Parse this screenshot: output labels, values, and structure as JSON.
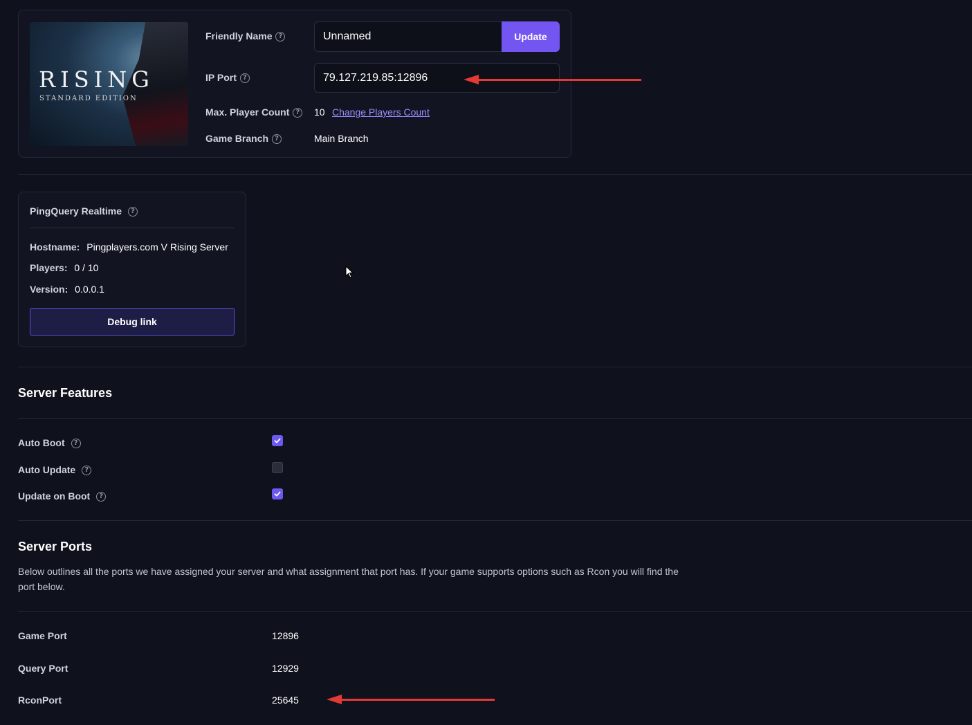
{
  "cover": {
    "title": "RISING",
    "edition": "STANDARD EDITION"
  },
  "info": {
    "friendly_name_label": "Friendly Name",
    "friendly_name_value": "Unnamed",
    "update_label": "Update",
    "ip_port_label": "IP Port",
    "ip_port_value": "79.127.219.85:12896",
    "max_players_label": "Max. Player Count",
    "max_players_value": "10",
    "change_players_link": "Change Players Count",
    "game_branch_label": "Game Branch",
    "game_branch_value": "Main Branch"
  },
  "ping": {
    "title": "PingQuery Realtime",
    "hostname_label": "Hostname:",
    "hostname_value": "Pingplayers.com V Rising Server",
    "players_label": "Players:",
    "players_value": "0 / 10",
    "version_label": "Version:",
    "version_value": "0.0.0.1",
    "debug_label": "Debug link"
  },
  "features": {
    "title": "Server Features",
    "items": [
      {
        "label": "Auto Boot",
        "checked": true
      },
      {
        "label": "Auto Update",
        "checked": false
      },
      {
        "label": "Update on Boot",
        "checked": true
      }
    ]
  },
  "ports": {
    "title": "Server Ports",
    "description": "Below outlines all the ports we have assigned your server and what assignment that port has. If your game supports options such as Rcon you will find the port below.",
    "rows": [
      {
        "label": "Game Port",
        "value": "12896"
      },
      {
        "label": "Query Port",
        "value": "12929"
      },
      {
        "label": "RconPort",
        "value": "25645"
      }
    ]
  },
  "colors": {
    "accent": "#7356f1",
    "background": "#0f121c",
    "annotation_arrow": "#e53935"
  },
  "icons": [
    "help-icon",
    "check-icon",
    "arrow-annotation",
    "mouse-cursor"
  ]
}
